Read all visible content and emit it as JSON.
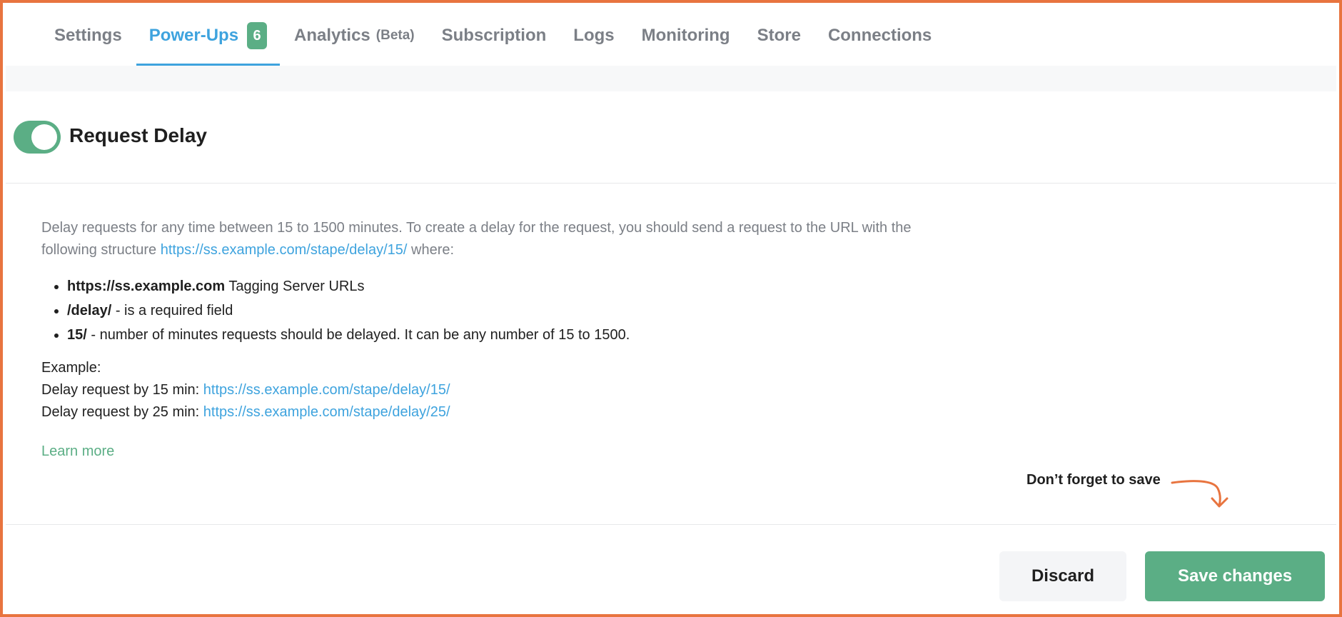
{
  "tabs": [
    {
      "label": "Settings"
    },
    {
      "label": "Power-Ups",
      "badge": "6",
      "active": true
    },
    {
      "label": "Analytics",
      "sub": "(Beta)"
    },
    {
      "label": "Subscription"
    },
    {
      "label": "Logs"
    },
    {
      "label": "Monitoring"
    },
    {
      "label": "Store"
    },
    {
      "label": "Connections"
    }
  ],
  "section": {
    "title": "Request Delay",
    "toggle_on": true
  },
  "description": {
    "text_before": "Delay requests for any time between 15 to 1500 minutes. To create a delay for the request, you should send a request to the URL with the following structure ",
    "url": "https://ss.example.com/stape/delay/15/",
    "text_after": " where:"
  },
  "bullets": [
    {
      "bold": "https://ss.example.com",
      "text": " Tagging Server URLs"
    },
    {
      "bold": "/delay/",
      "text": " - is a required field"
    },
    {
      "bold": "15/",
      "text": " - number of minutes requests should be delayed. It can be any number of 15 to 1500."
    }
  ],
  "example": {
    "heading": "Example:",
    "line1_label": "Delay request by 15 min: ",
    "line1_url": "https://ss.example.com/stape/delay/15/",
    "line2_label": "Delay request by 25 min: ",
    "line2_url": "https://ss.example.com/stape/delay/25/"
  },
  "learn_more": "Learn more",
  "reminder": "Don’t forget to save",
  "buttons": {
    "discard": "Discard",
    "save": "Save changes"
  },
  "colors": {
    "accent_blue": "#3ea3de",
    "accent_green": "#5bae85",
    "frame_orange": "#e8743f"
  }
}
